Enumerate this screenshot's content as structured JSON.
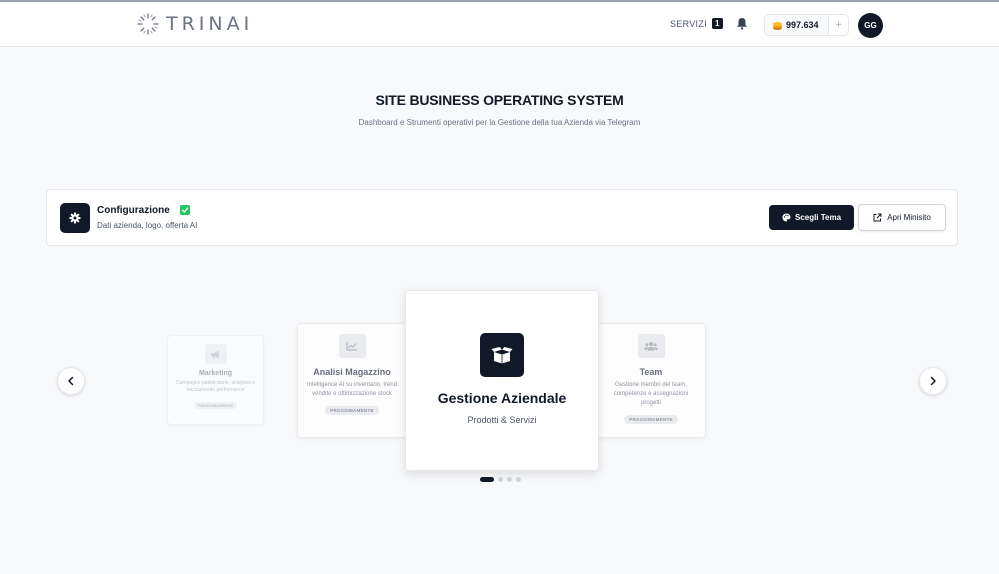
{
  "header": {
    "logo_text": "TRINAI",
    "servizi_label": "SERVIZI",
    "servizi_count": "1",
    "credits": "997.634",
    "credits_plus": "+",
    "avatar_initials": "GG"
  },
  "hero": {
    "title": "SITE BUSINESS OPERATING SYSTEM",
    "subtitle": "Dashboard e Strumenti operativi per la Gestione della tua Azienda via Telegram"
  },
  "config": {
    "title": "Configurazione",
    "description": "Dati azienda, logo, offerta AI",
    "theme_button": "Scegli Tema",
    "minisite_button": "Apri Minisito"
  },
  "carousel": {
    "cards": [
      {
        "title": "Marketing",
        "description": "Campagne pubblicitarie, analytics e tracciamento performance",
        "badge": "PROSSIMAMENTE",
        "icon": "megaphone-icon"
      },
      {
        "title": "Analisi Magazzino",
        "description": "Intelligence AI su inventario, trend vendite e ottimizzazione stock",
        "badge": "PROSSIMAMENTE",
        "icon": "chart-line-icon"
      },
      {
        "title": "Gestione Aziendale",
        "description": "Prodotti & Servizi",
        "icon": "box-open-icon"
      },
      {
        "title": "Team",
        "description": "Gestione membri del team, competenze e assegnazioni progetti",
        "badge": "PROSSIMAMENTE",
        "icon": "users-icon"
      }
    ],
    "active_index": 0,
    "total_dots": 4
  },
  "colors": {
    "primary": "#111827",
    "success": "#22c55e",
    "coin": "#f59e0b"
  }
}
